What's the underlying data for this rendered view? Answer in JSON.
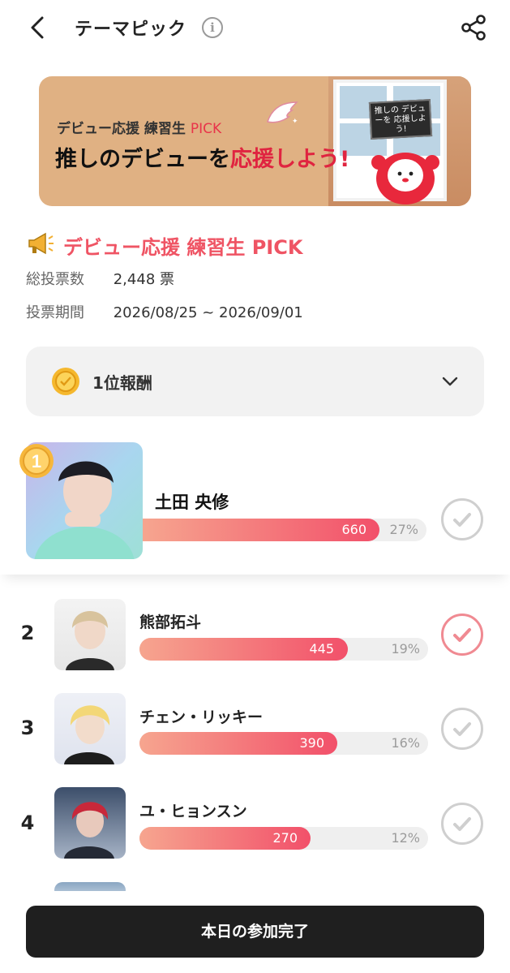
{
  "header": {
    "title": "テーマピック",
    "info_icon": "info-icon",
    "back_icon": "chevron-left-icon",
    "share_icon": "share-icon"
  },
  "banner": {
    "subtitle": "デビュー応援 練習生",
    "subtitle_pick": "PICK",
    "headline_pre": "推しのデビューを",
    "headline_accent": "応援しよう!",
    "sign_text": "推しの デビューを 応援しよう!"
  },
  "theme": {
    "title": "デビュー応援 練習生 PICK",
    "total_votes_label": "総投票数",
    "total_votes_value": "2,448",
    "total_votes_unit": "票",
    "period_label": "投票期間",
    "period_value": "2026/08/25 ~ 2026/09/01"
  },
  "reward": {
    "label": "1位報酬",
    "icon": "coin-icon"
  },
  "candidates": [
    {
      "rank": "1",
      "name": "土田 央修",
      "votes": "660",
      "percent": "27%",
      "fill": 0.83,
      "checked": false
    },
    {
      "rank": "2",
      "name": "熊部拓斗",
      "votes": "445",
      "percent": "19%",
      "fill": 0.72,
      "checked": true
    },
    {
      "rank": "3",
      "name": "チェン・リッキー",
      "votes": "390",
      "percent": "16%",
      "fill": 0.68,
      "checked": false
    },
    {
      "rank": "4",
      "name": "ユ・ヒョンスン",
      "votes": "270",
      "percent": "12%",
      "fill": 0.59,
      "checked": false
    }
  ],
  "footer": {
    "button_label": "本日の参加完了"
  },
  "colors": {
    "accent": "#ef5464",
    "bar_start": "#f6a58f",
    "bar_end": "#f2506a",
    "button_bg": "#1f1f1f"
  }
}
